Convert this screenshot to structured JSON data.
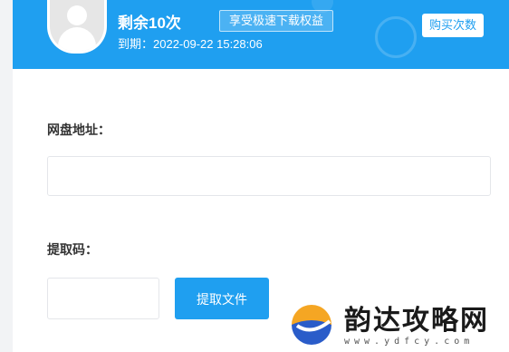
{
  "header": {
    "remaining": "剩余10次",
    "perk_badge": "享受极速下载权益",
    "expiry": "到期：2022-09-22 15:28:06",
    "buy_button": "购买次数"
  },
  "form": {
    "url_label": "网盘地址：",
    "url_value": "",
    "code_label": "提取码：",
    "code_value": "",
    "extract_button": "提取文件"
  },
  "watermark": {
    "name": "韵达攻略网",
    "url": "www.ydfcy.com"
  },
  "colors": {
    "accent": "#1f9ff0",
    "header_bg": "#1f9ff0"
  }
}
